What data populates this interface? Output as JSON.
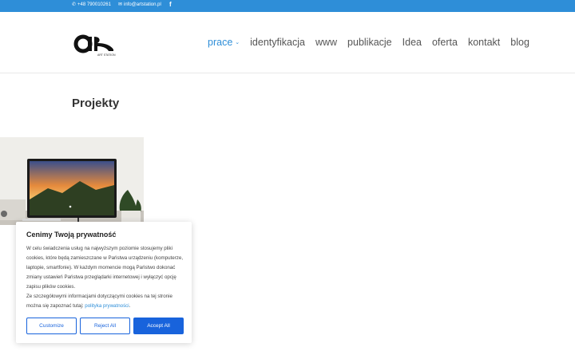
{
  "topbar": {
    "phone": "+48 790010261",
    "email": "info@artstation.pl",
    "social": "f"
  },
  "brand": {
    "logo_text": "ART STATION"
  },
  "nav": {
    "items": [
      {
        "label": "prace"
      },
      {
        "label": "identyfikacja"
      },
      {
        "label": "www"
      },
      {
        "label": "publikacje"
      },
      {
        "label": "Idea"
      },
      {
        "label": "oferta"
      },
      {
        "label": "kontakt"
      },
      {
        "label": "blog"
      }
    ]
  },
  "page": {
    "title": "Projekty"
  },
  "cookie": {
    "title": "Cenimy Twoją prywatność",
    "body_1": "W celu świadczenia usług na najwyższym poziomie stosujemy pliki cookies, które będą zamieszczane w Państwa urządzeniu (komputerze, laptopie, smartfonie). W każdym momencie mogą Państwo dokonać zmiany ustawień Państwa przeglądarki internetowej i wyłączyć opcję zapisu plików cookies.",
    "body_2": "Ze szczegółowymi informacjami dotyczącymi cookies na tej stronie można się zapoznać tutaj:",
    "link": "polityka prywatności",
    "after_link": ".",
    "customize": "Customize",
    "reject": "Reject All",
    "accept": "Accept All"
  },
  "colors": {
    "accent": "#2e8ed8",
    "button": "#1863dc"
  }
}
